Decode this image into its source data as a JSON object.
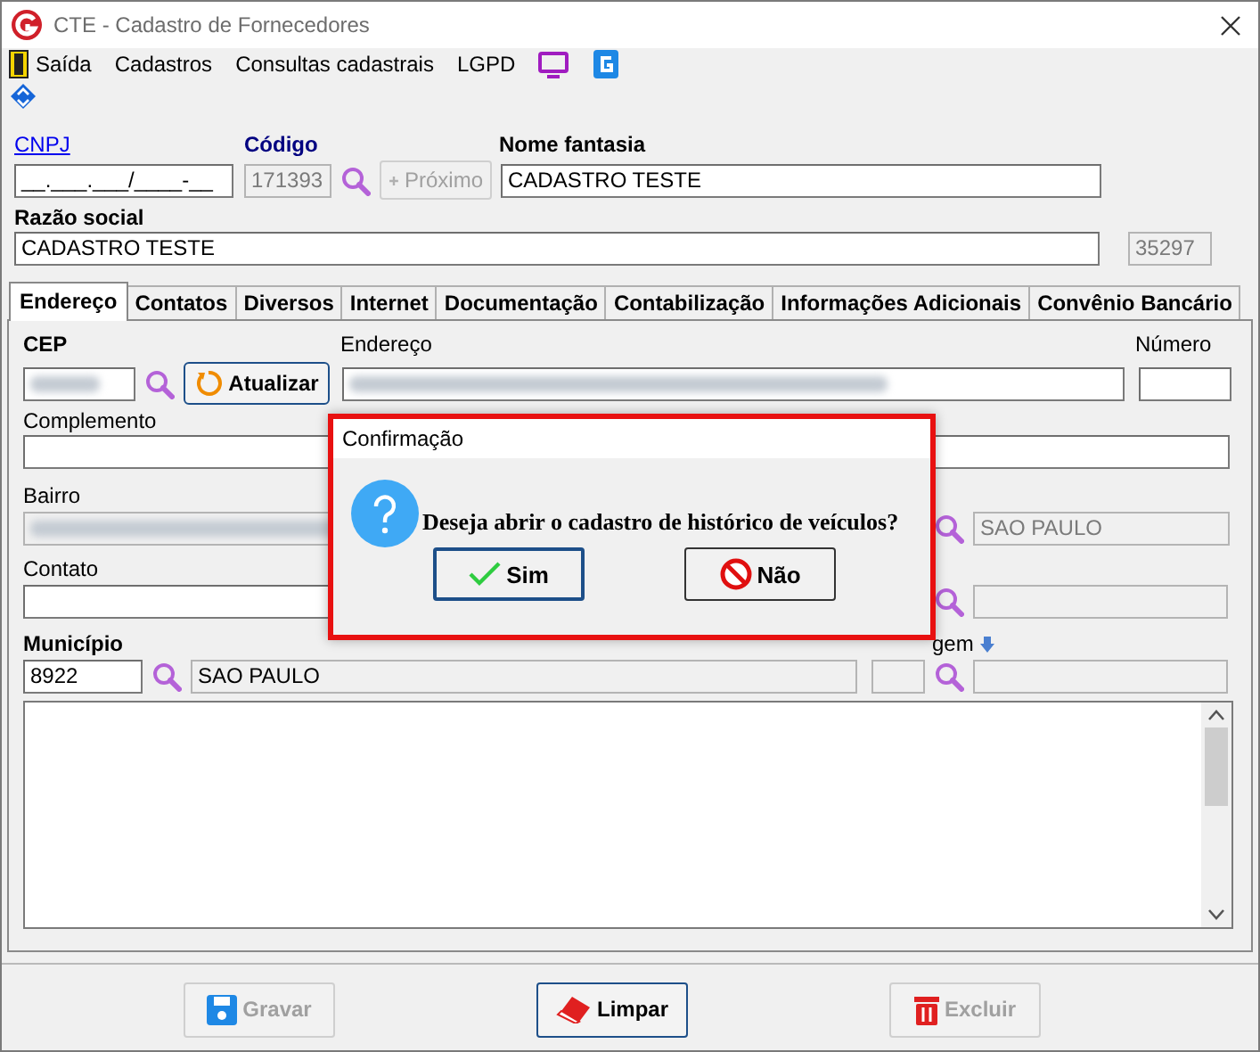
{
  "window": {
    "title": "CTE - Cadastro de Fornecedores"
  },
  "menu": [
    {
      "label": "Saída",
      "kind": "exit"
    },
    {
      "label": "Cadastros",
      "kind": "text"
    },
    {
      "label": "Consultas cadastrais",
      "kind": "text"
    },
    {
      "label": "LGPD",
      "kind": "text"
    }
  ],
  "header": {
    "cnpj": {
      "label": "CNPJ",
      "value": "__.___.___/____-__"
    },
    "codigo": {
      "label": "Código",
      "value": "171393",
      "disabled": true
    },
    "next_button": {
      "label": "Próximo",
      "disabled": true
    },
    "nome_fantasia": {
      "label": "Nome fantasia",
      "value": "CADASTRO TESTE"
    },
    "razao_social": {
      "label": "Razão social",
      "value": "CADASTRO TESTE"
    },
    "code_2": {
      "value": "35297",
      "disabled": true
    }
  },
  "tabs": [
    {
      "label": "Endereço",
      "selected": true
    },
    {
      "label": "Contatos",
      "selected": false
    },
    {
      "label": "Diversos",
      "selected": false
    },
    {
      "label": "Internet",
      "selected": false
    },
    {
      "label": "Documentação",
      "selected": false
    },
    {
      "label": "Contabilização",
      "selected": false
    },
    {
      "label": "Informações Adicionais",
      "selected": false
    },
    {
      "label": "Convênio Bancário",
      "selected": false
    }
  ],
  "address": {
    "cep": {
      "label": "CEP",
      "redacted": true
    },
    "refresh_button": {
      "label": "Atualizar"
    },
    "endereco": {
      "label": "Endereço",
      "redacted": true
    },
    "numero": {
      "label": "Número"
    },
    "complemento": {
      "label": "Complemento"
    },
    "bairro": {
      "label": "Bairro",
      "redacted": true,
      "disabled": true
    },
    "cidade": {
      "value": "SAO PAULO",
      "disabled": true
    },
    "contato": {
      "label": "Contato"
    },
    "municipio": {
      "label": "Município",
      "code": "8922",
      "name": "SAO PAULO"
    },
    "origem": {
      "label": "gem"
    }
  },
  "dialog": {
    "title": "Confirmação",
    "message": "Deseja abrir o cadastro de histórico de veículos?",
    "buttons": [
      {
        "label": "Sim",
        "kind": "yes",
        "focused": true
      },
      {
        "label": "Não",
        "kind": "no",
        "focused": false
      }
    ]
  },
  "footer_buttons": [
    {
      "label": "Gravar",
      "kind": "save",
      "disabled": true
    },
    {
      "label": "Limpar",
      "kind": "clear",
      "disabled": false
    },
    {
      "label": "Excluir",
      "kind": "delete",
      "disabled": true
    }
  ]
}
